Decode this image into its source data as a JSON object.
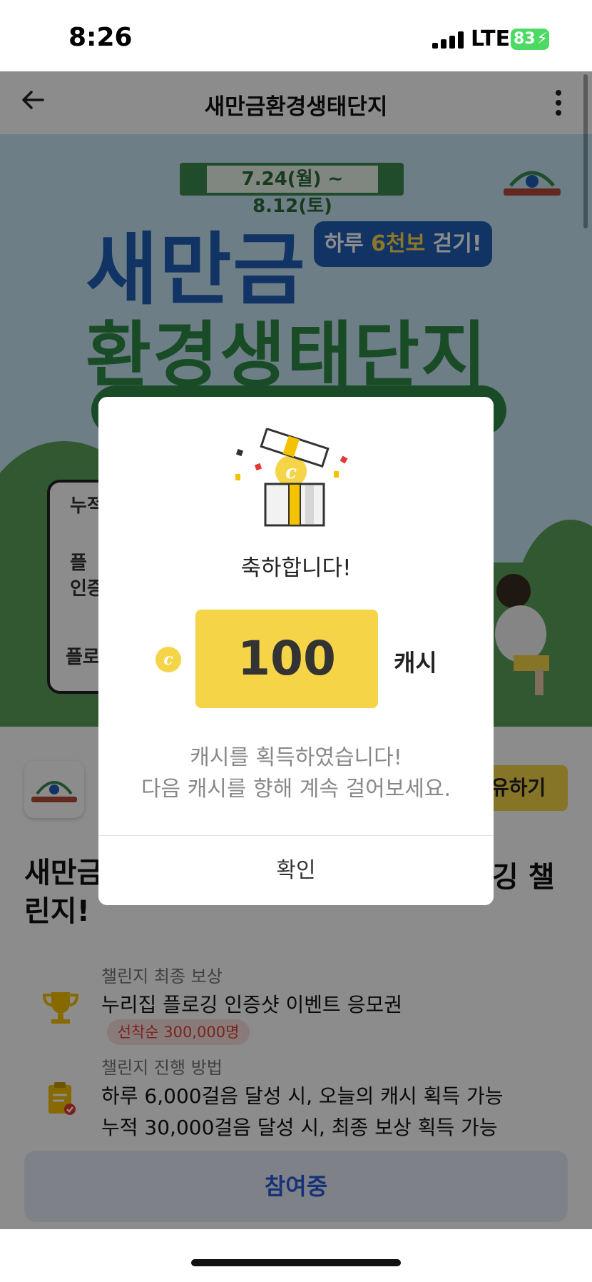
{
  "status_bar": {
    "time": "8:26",
    "network": "LTE",
    "battery": "83"
  },
  "header": {
    "title": "새만금환경생태단지",
    "back_icon": "arrow-left-icon",
    "more_icon": "more-vertical-icon"
  },
  "banner": {
    "date_range": "7.24(월) ~ 8.12(토)",
    "title_line1": "새만금",
    "title_line2": "환경생태단지",
    "bubble_prefix": "하루 ",
    "bubble_highlight": "6천보",
    "bubble_suffix": " 걷기!",
    "card_label1": "누적",
    "card_label2": "플",
    "card_label3": "인증",
    "card_label4": "플로",
    "colors": {
      "blue": "#1f5fb8",
      "green": "#2f8a45",
      "yellow": "#ffd84a"
    }
  },
  "content": {
    "share_label": "유하기",
    "challenge_title_left": "새만금",
    "challenge_title_right": "깅 챌",
    "challenge_title_line2": "린지!",
    "reward": {
      "label": "챌린지 최종 보상",
      "value": "누리집 플로깅 인증샷 이벤트 응모권",
      "badge": "선착순 300,000명"
    },
    "method": {
      "label": "챌린지 진행 방법",
      "line1": "하루 6,000걸음 달성 시, 오늘의 캐시 획득 가능",
      "line2": "누적 30,000걸음 달성 시, 최종 보상 획득 가능"
    },
    "join_button": "참여중"
  },
  "modal": {
    "congrats": "축하합니다!",
    "amount": "100",
    "unit": "캐시",
    "coin_glyph": "c",
    "message_line1": "캐시를 획득하였습니다!",
    "message_line2": "다음 캐시를 향해 계속 걸어보세요.",
    "confirm": "확인",
    "accent_color": "#f5d448"
  }
}
